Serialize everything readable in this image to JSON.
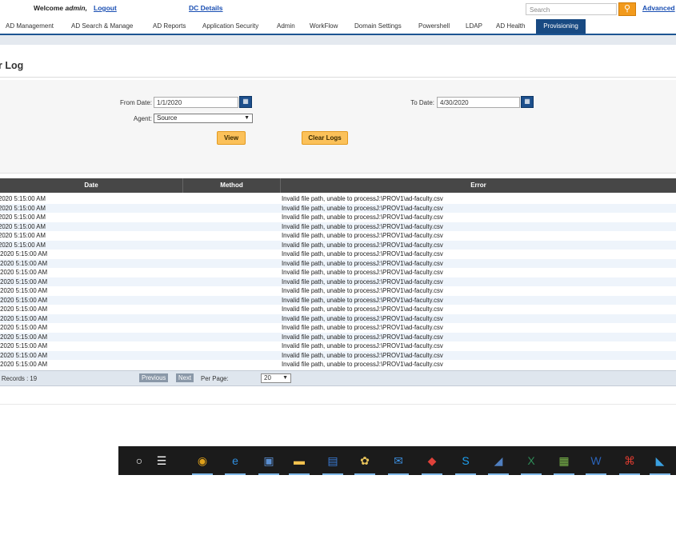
{
  "header": {
    "welcome_prefix": "Welcome",
    "user": "admin,",
    "logout": "Logout",
    "dc_details": "DC Details",
    "search_placeholder": "Search",
    "advanced": "Advanced"
  },
  "nav": {
    "items": [
      "AD Management",
      "AD Search & Manage",
      "AD Reports",
      "Application Security",
      "Admin",
      "WorkFlow",
      "Domain Settings",
      "Powershell",
      "LDAP",
      "AD Health"
    ],
    "active": "Provisioning"
  },
  "page": {
    "title": "r Log"
  },
  "form": {
    "from_label": "From Date:",
    "from_value": "1/1/2020",
    "to_label": "To Date:",
    "to_value": "4/30/2020",
    "agent_label": "Agent:",
    "agent_value": "Source",
    "view_button": "View",
    "clear_button": "Clear Logs"
  },
  "table": {
    "columns": [
      "Date",
      "Method",
      "Error"
    ],
    "rows": [
      {
        "date": "2020 5:15:00 AM",
        "method": "",
        "error": "Invalid file path, unable to processJ:\\PROV1\\ad-faculty.csv"
      },
      {
        "date": "2020 5:15:00 AM",
        "method": "",
        "error": "Invalid file path, unable to processJ:\\PROV1\\ad-faculty.csv"
      },
      {
        "date": "2020 5:15:00 AM",
        "method": "",
        "error": "Invalid file path, unable to processJ:\\PROV1\\ad-faculty.csv"
      },
      {
        "date": "2020 5:15:00 AM",
        "method": "",
        "error": "Invalid file path, unable to processJ:\\PROV1\\ad-faculty.csv"
      },
      {
        "date": "2020 5:15:00 AM",
        "method": "",
        "error": "Invalid file path, unable to processJ:\\PROV1\\ad-faculty.csv"
      },
      {
        "date": "2020 5:15:00 AM",
        "method": "",
        "error": "Invalid file path, unable to processJ:\\PROV1\\ad-faculty.csv"
      },
      {
        "date": "/2020 5:15:00 AM",
        "method": "",
        "error": "Invalid file path, unable to processJ:\\PROV1\\ad-faculty.csv"
      },
      {
        "date": "/2020 5:15:00 AM",
        "method": "",
        "error": "Invalid file path, unable to processJ:\\PROV1\\ad-faculty.csv"
      },
      {
        "date": "/2020 5:15:00 AM",
        "method": "",
        "error": "Invalid file path, unable to processJ:\\PROV1\\ad-faculty.csv"
      },
      {
        "date": "/2020 5:15:00 AM",
        "method": "",
        "error": "Invalid file path, unable to processJ:\\PROV1\\ad-faculty.csv"
      },
      {
        "date": "/2020 5:15:00 AM",
        "method": "",
        "error": "Invalid file path, unable to processJ:\\PROV1\\ad-faculty.csv"
      },
      {
        "date": "/2020 5:15:00 AM",
        "method": "",
        "error": "Invalid file path, unable to processJ:\\PROV1\\ad-faculty.csv"
      },
      {
        "date": "/2020 5:15:00 AM",
        "method": "",
        "error": "Invalid file path, unable to processJ:\\PROV1\\ad-faculty.csv"
      },
      {
        "date": "/2020 5:15:00 AM",
        "method": "",
        "error": "Invalid file path, unable to processJ:\\PROV1\\ad-faculty.csv"
      },
      {
        "date": "/2020 5:15:00 AM",
        "method": "",
        "error": "Invalid file path, unable to processJ:\\PROV1\\ad-faculty.csv"
      },
      {
        "date": "/2020 5:15:00 AM",
        "method": "",
        "error": "Invalid file path, unable to processJ:\\PROV1\\ad-faculty.csv"
      },
      {
        "date": "/2020 5:15:00 AM",
        "method": "",
        "error": "Invalid file path, unable to processJ:\\PROV1\\ad-faculty.csv"
      },
      {
        "date": "/2020 5:15:00 AM",
        "method": "",
        "error": "Invalid file path, unable to processJ:\\PROV1\\ad-faculty.csv"
      },
      {
        "date": "/2020 5:15:00 AM",
        "method": "",
        "error": "Invalid file path, unable to processJ:\\PROV1\\ad-faculty.csv"
      }
    ]
  },
  "pager": {
    "records": "l Records :  19",
    "previous": "Previous",
    "next": "Next",
    "per_page_label": "Per Page:",
    "per_page_value": "20"
  },
  "taskbar": {
    "icons": [
      "cortana-icon",
      "task-view-icon",
      "chrome-icon",
      "edge-icon",
      "network-icon",
      "file-explorer-icon",
      "remote-desktop-icon",
      "paint-icon",
      "mail-icon",
      "security-icon",
      "skype-icon",
      "notebook-icon",
      "excel-icon",
      "project-icon",
      "word-icon",
      "acrobat-icon",
      "photos-icon"
    ]
  },
  "colors": {
    "nav_active": "#184a82",
    "accent_orange": "#fbc15a",
    "table_header": "#474747",
    "link": "#1a4fb3"
  }
}
